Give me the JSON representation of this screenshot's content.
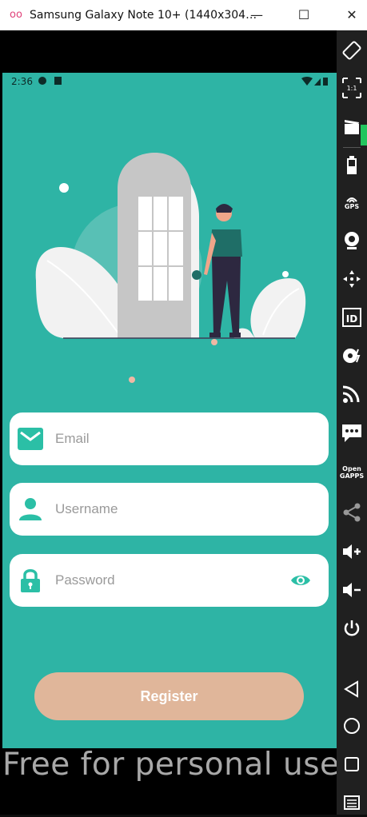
{
  "window": {
    "title": "Samsung Galaxy Note 10+ (1440x304…",
    "minimize": "—",
    "maximize": "☐",
    "close": "✕"
  },
  "status_bar": {
    "time": "2:36"
  },
  "form": {
    "email_placeholder": "Email",
    "username_placeholder": "Username",
    "password_placeholder": "Password",
    "register_label": "Register"
  },
  "watermark": "Free for personal use",
  "sidebar": {
    "gps_label": "GPS",
    "id_label": "ID",
    "ratio_label": "1:1",
    "opengapps_label_1": "Open",
    "opengapps_label_2": "GAPPS"
  },
  "colors": {
    "screen_bg": "#2eb4a5",
    "field_icon": "#2bbfa6",
    "register_bg": "#e0b69a",
    "sidebar_bg": "#202020"
  }
}
